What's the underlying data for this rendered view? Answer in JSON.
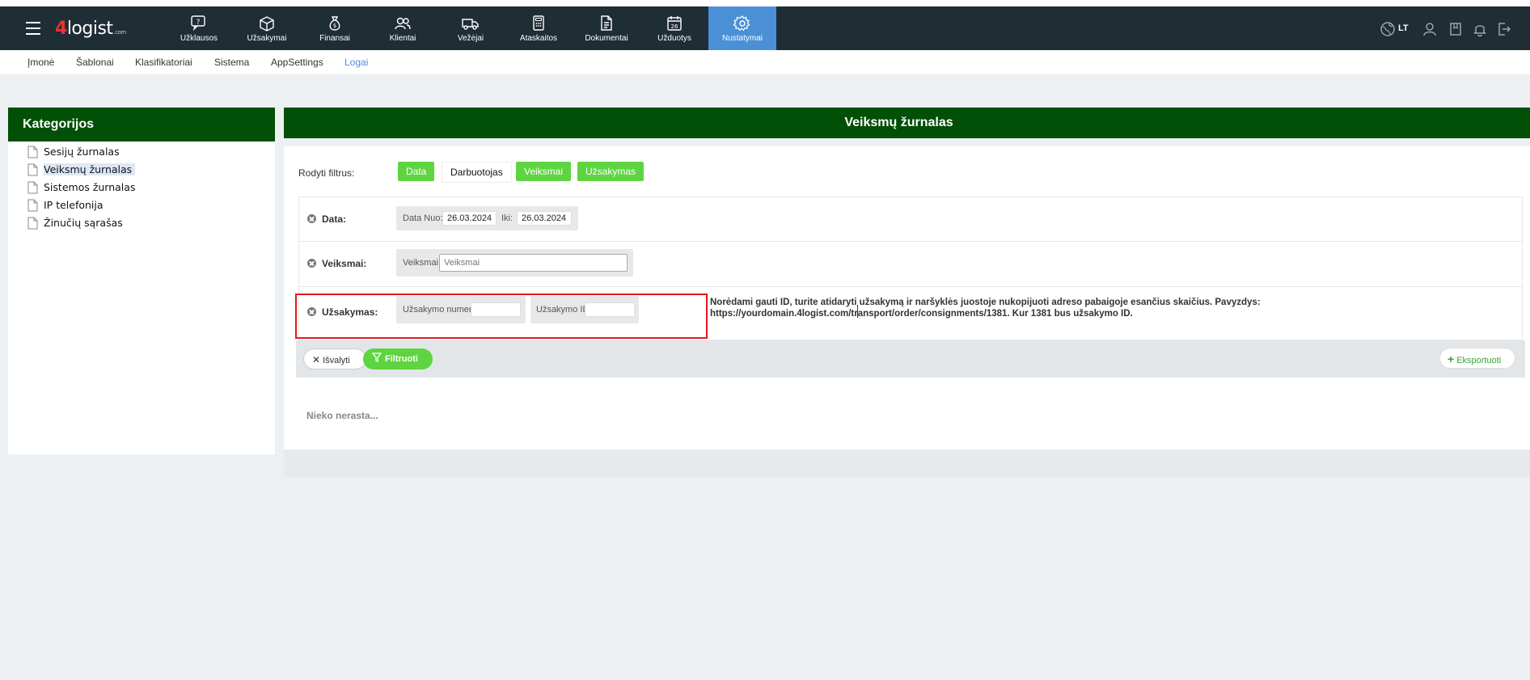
{
  "brand": {
    "four": "4",
    "rest": "logist",
    "suffix": ".com"
  },
  "nav": [
    {
      "label": "Užklausos",
      "icon": "question-chat-icon"
    },
    {
      "label": "Užsakymai",
      "icon": "box-icon"
    },
    {
      "label": "Finansai",
      "icon": "money-bag-icon"
    },
    {
      "label": "Klientai",
      "icon": "users-icon"
    },
    {
      "label": "Vežėjai",
      "icon": "truck-icon"
    },
    {
      "label": "Ataskaitos",
      "icon": "calculator-icon"
    },
    {
      "label": "Dokumentai",
      "icon": "document-icon"
    },
    {
      "label": "Užduotys",
      "icon": "calendar-icon",
      "badge": "26"
    },
    {
      "label": "Nustatymai",
      "icon": "gear-icon",
      "active": true
    }
  ],
  "right_nav": {
    "lang": "LT"
  },
  "subnav": [
    {
      "label": "Įmonė"
    },
    {
      "label": "Šablonai"
    },
    {
      "label": "Klasifikatoriai"
    },
    {
      "label": "Sistema"
    },
    {
      "label": "AppSettings"
    },
    {
      "label": "Logai",
      "active": true
    }
  ],
  "categories": {
    "title": "Kategorijos",
    "items": [
      {
        "label": "Sesijų žurnalas"
      },
      {
        "label": "Veiksmų žurnalas",
        "selected": true
      },
      {
        "label": "Sistemos žurnalas"
      },
      {
        "label": "IP telefonija"
      },
      {
        "label": "Žinučių sąrašas"
      }
    ]
  },
  "main": {
    "title": "Veiksmų žurnalas",
    "show_filters_label": "Rodyti filtrus:",
    "filter_chips": [
      {
        "label": "Data",
        "on": true
      },
      {
        "label": "Darbuotojas",
        "on": false
      },
      {
        "label": "Veiksmai",
        "on": true
      },
      {
        "label": "Užsakymas",
        "on": true
      }
    ],
    "date_row": {
      "label": "Data:",
      "from_label": "Data Nuo:",
      "from_value": "26.03.2024",
      "to_label": "Iki:",
      "to_value": "26.03.2024"
    },
    "actions_row": {
      "label": "Veiksmai:",
      "field_label": "Veiksmai:",
      "placeholder": "Veiksmai"
    },
    "order_row": {
      "label": "Užsakymas:",
      "number_label": "Užsakymo numeris",
      "id_label": "Užsakymo ID",
      "hint_line1": "Norėdami gauti ID, turite atidaryti užsakymą ir naršyklės juostoje nukopijuoti adreso pabaigoje esančius skaičius. Pavyzdys:",
      "hint_line2": "https://yourdomain.4logist.com/transport/order/consignments/1381. Kur 1381 bus užsakymo ID."
    },
    "buttons": {
      "clear": "Išvalyti",
      "filter": "Filtruoti",
      "export": "Eksportuoti"
    },
    "empty_text": "Nieko nerasta..."
  },
  "colors": {
    "navbar": "#1f2d35",
    "active_nav": "#4b90d6",
    "panel_header": "#024f07",
    "green": "#5ed540",
    "highlight": "#e0191e"
  }
}
